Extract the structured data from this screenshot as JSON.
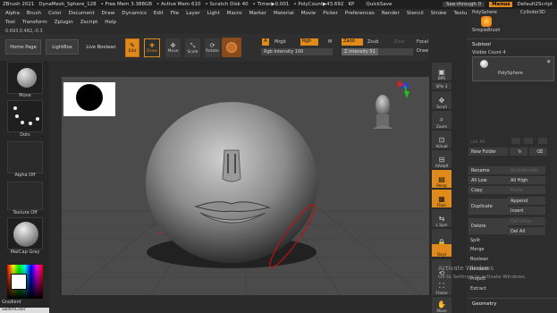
{
  "titlebar": {
    "app": "ZBrush 2021",
    "doc": "DynaMesh_Sphere_128",
    "free_mem": "• Free Mem 3.388GB",
    "active_mem": "• Active Mem 610",
    "scratch": "• Scratch Disk 40",
    "timer": "• Timer▶0.001",
    "polycount": "• PolyCount▶43.692",
    "kp": "KP",
    "quicksave": "QuickSave",
    "see_through": "See-through 0",
    "menus": "Menus",
    "script": "Default2Script"
  },
  "menubar": {
    "row1": [
      "Alpha",
      "Brush",
      "Color",
      "Document",
      "Draw",
      "Dynamics",
      "Edit",
      "File",
      "Layer",
      "Light",
      "Macro",
      "Marker",
      "Material",
      "Movie",
      "Picker",
      "Preferences",
      "Render",
      "Stencil",
      "Stroke",
      "Texture"
    ],
    "row2": [
      "Tool",
      "Transform",
      "Zplugin",
      "Zscript",
      "Help"
    ]
  },
  "coords": "0.693,0.482,-0.3",
  "shelf": {
    "home": "Home Page",
    "lightbox": "LightBox",
    "live_boolean": "Live Boolean",
    "edit": "Edit",
    "draw": "Draw",
    "move": "Move",
    "scale": "Scale",
    "rotate": "Rotate",
    "a_label": "A",
    "mrgb": "Mrgb",
    "rgb": "Rgb",
    "m": "M",
    "rgb_intensity": "Rgb Intensity 100",
    "zadd": "Zadd",
    "zsub": "Zsub",
    "zcut": "Zcut",
    "z_intensity": "Z Intensity 51",
    "focal": "Focal",
    "draw_size": "Draw"
  },
  "lefttray": {
    "brush": "Move",
    "stroke": "Dots",
    "alpha": "Alpha Off",
    "texture": "Texture Off",
    "material": "MatCap Gray",
    "gradient": "Gradient",
    "switch": "SwitchColor"
  },
  "righttray": {
    "bpr": "BPR",
    "spix": "SPix 3",
    "scroll": "Scroll",
    "zoom": "Zoom",
    "actual": "Actual",
    "aahalf": "AAHalf",
    "persp": "Persp",
    "floor": "Floor",
    "lsym": "L.Sym",
    "xyz": "Qxyz",
    "frame": "Frame",
    "move": "Move"
  },
  "rpanel": {
    "polysphere": "PolySphere",
    "cylinder": "Cylinder3D",
    "simplebrush": "SimpleBrush",
    "subtool": "Subtool",
    "visible_count": "Visible Count 4",
    "polysphere_item": "PolySphere",
    "list_all": "List All",
    "new_folder": "New Folder",
    "rename": "Rename",
    "autoreorder": "AutoReorder",
    "all_low": "All Low",
    "all_high": "All High",
    "copy": "Copy",
    "paste": "Paste",
    "duplicate": "Duplicate",
    "append": "Append",
    "insert": "Insert",
    "delete": "Delete",
    "del_other": "Del Other",
    "del_all": "Del All",
    "split": "Split",
    "merge": "Merge",
    "boolean": "Boolean",
    "remesh": "Remesh",
    "project": "Project",
    "extract": "Extract",
    "geometry": "Geometry"
  },
  "watermark": {
    "line1": "Activate Windows",
    "line2": "Go to Settings to activate Windows."
  },
  "colors": {
    "accent": "#e08a1c",
    "canvas": "#4b4b4b"
  }
}
